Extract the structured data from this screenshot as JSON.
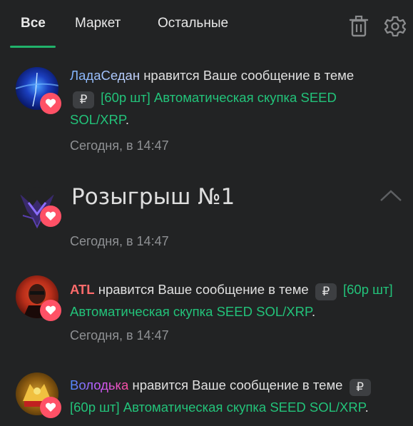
{
  "tabs": [
    {
      "label": "Все",
      "active": true
    },
    {
      "label": "Маркет",
      "active": false
    },
    {
      "label": "Остальные",
      "active": false
    }
  ],
  "icons": {
    "delete": "trash-icon",
    "settings": "gear-icon",
    "like": "heart-icon",
    "ruble": "ruble-icon",
    "collapse": "chevron-up-icon"
  },
  "colors": {
    "accent": "#21b26b",
    "link": "#22c37a",
    "heart": "#ff5166",
    "background": "#222324"
  },
  "notifications": [
    {
      "user": "ЛадаСедан",
      "text": "нравится Ваше сообщение в теме",
      "tag": "₽",
      "thread": "[60р шт] Автоматическая скупка SEED SOL/XRP",
      "end": ".",
      "time": "Сегодня, в 14:47"
    },
    {
      "title": "Розыгрыш №1",
      "time": "Сегодня, в 14:47"
    },
    {
      "user": "ATL",
      "text": "нравится Ваше сообщение в теме",
      "tag": "₽",
      "thread": "[60р шт] Автоматическая скупка SEED SOL/XRP",
      "end": ".",
      "time": "Сегодня, в 14:47"
    },
    {
      "user": "Володька",
      "text": "нравится Ваше сообщение в теме",
      "tag": "₽",
      "thread": "[60р шт] Автоматическая скупка SEED SOL/XRP",
      "end": "."
    }
  ]
}
